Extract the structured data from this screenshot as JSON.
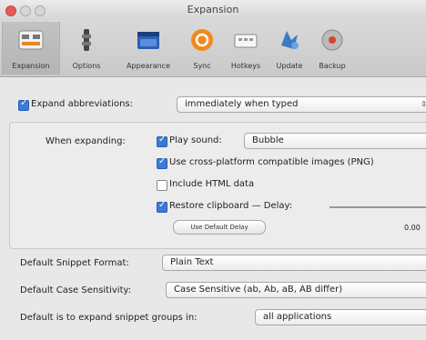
{
  "window": {
    "title": "Expansion"
  },
  "toolbar": {
    "items": [
      {
        "label": "Expansion",
        "icon": "expansion-icon"
      },
      {
        "label": "Options",
        "icon": "options-icon"
      },
      {
        "label": "Appearance",
        "icon": "appearance-icon"
      },
      {
        "label": "Sync",
        "icon": "sync-icon"
      },
      {
        "label": "Hotkeys",
        "icon": "hotkeys-icon"
      },
      {
        "label": "Update",
        "icon": "update-icon"
      },
      {
        "label": "Backup",
        "icon": "backup-icon"
      }
    ]
  },
  "expand": {
    "label": "Expand abbreviations:",
    "value": "immediately when typed",
    "checked": true
  },
  "when_expanding": {
    "label": "When expanding:",
    "play_sound_label": "Play sound:",
    "play_sound_value": "Bubble",
    "cross_platform_label": "Use cross-platform compatible images (PNG)",
    "include_html_label": "Include HTML data",
    "restore_clipboard_label": "Restore clipboard — Delay:",
    "use_default_button": "Use Default Delay",
    "delay_value": "0.00"
  },
  "snippet_format": {
    "label": "Default Snippet Format:",
    "value": "Plain Text"
  },
  "case_sensitivity": {
    "label": "Default Case Sensitivity:",
    "value": "Case Sensitive (ab, Ab, aB, AB differ)"
  },
  "groups": {
    "label": "Default is to expand snippet groups in:",
    "value": "all applications"
  },
  "colors": {
    "accent": "#3a7bd5",
    "close": "#e65a53"
  }
}
